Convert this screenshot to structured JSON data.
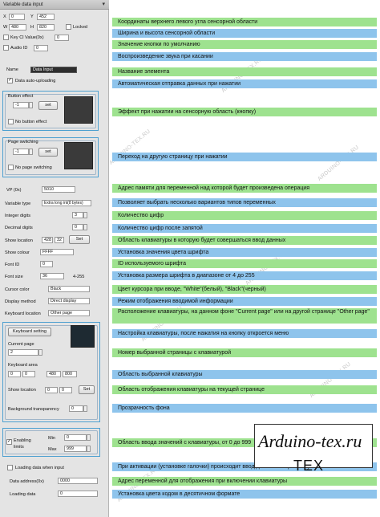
{
  "panel": {
    "title": "Variable data input",
    "close_glyph": "▾",
    "x_label": "X",
    "x_value": "0",
    "y_label": "Y",
    "y_value": "452",
    "w_label": "W",
    "w_value": "480",
    "h_label": "H",
    "h_value": "820",
    "locked_label": "Locked",
    "key_cl_label": "Key Cl Value(0x)",
    "key_cl_value": "0",
    "audio_id_label": "Audio ID",
    "audio_id_value": "0",
    "name_label": "Name",
    "name_value": "Data Input",
    "data_auto_uploading_label": "Data auto-uploading",
    "button_effect_label": "Button effect",
    "button_effect_value": "-1",
    "set_label": "set",
    "no_button_effect_label": "No button effect",
    "page_switching_label": "Page switching",
    "page_switching_value": "-1",
    "no_page_switching_label": "No page switching",
    "vp_label": "VP (0x)",
    "vp_value": "5010",
    "variable_type_label": "Variable type",
    "variable_type_value": "Extra long int(8 bytes)",
    "integer_digits_label": "Integer digits",
    "integer_digits_value": "3",
    "decimal_digits_label": "Decimal digits",
    "decimal_digits_value": "0",
    "show_location_label": "Show location",
    "show_location_x": "428",
    "show_location_y": "32",
    "set_button_label": "Set",
    "show_colour_label": "Show colour",
    "show_colour_value": "FFFF",
    "font_id_label": "Font ID",
    "font_id_value": "0",
    "font_size_label": "Font size",
    "font_size_value": "36",
    "font_size_range": "4-255",
    "cursor_color_label": "Cursor color",
    "cursor_color_value": "Black",
    "display_method_label": "Display method",
    "display_method_value": "Direct display",
    "keyboard_location_label": "Keyboard location",
    "keyboard_location_value": "Other page",
    "keyboard_setting_label": "Keyboard setting",
    "current_page_label": "Current page",
    "current_page_value": "2",
    "keyboard_area_label": "Keyboard area",
    "ka_x1": "0",
    "ka_y1": "0",
    "ka_x2": "480",
    "ka_y2": "800",
    "kb_show_location_label": "Show location",
    "kb_show_x": "0",
    "kb_show_y": "0",
    "kb_set_label": "Set",
    "background_transparency_label": "Background transparency",
    "background_transparency_value": "0",
    "enabling_limits_label": "Enabling limits",
    "min_label": "Min",
    "min_value": "0",
    "max_label": "Max",
    "max_value": "999",
    "loading_data_when_input_label": "Loading data when input",
    "data_address_label": "Data address(0x)",
    "data_address_value": "0000",
    "loading_data_label": "Loading data",
    "loading_data_value": "0"
  },
  "annotations": [
    {
      "text": "Координаты верхнего левого угла сенсорной области",
      "color": "green"
    },
    {
      "text": "Ширина и высота сенсорной области",
      "color": "blue"
    },
    {
      "text": "Значение кнопки по умолчанию",
      "color": "green"
    },
    {
      "text": "Воспроизведение звука при касании",
      "color": "blue"
    },
    {
      "text": "Название элемента",
      "color": "green"
    },
    {
      "text": "Автоматическая отправка данных при нажатии",
      "color": "blue"
    },
    {
      "text": "Эффект при нажатии на сенсорную область (кнопку)",
      "color": "green"
    },
    {
      "text": "Переход на другую страницу при нажатии",
      "color": "blue"
    },
    {
      "text": "Адрес памяти для переменной над которой будет произведена операция",
      "color": "green"
    },
    {
      "text": "Позволяет выбрать несколько вариантов типов переменных",
      "color": "blue"
    },
    {
      "text": "Количество цифр",
      "color": "green"
    },
    {
      "text": "Количество цифр после запятой",
      "color": "blue"
    },
    {
      "text": "Область клавиатуры в которую будет совершаться ввод данных",
      "color": "green"
    },
    {
      "text": "Установка значения цвета шрифта",
      "color": "blue"
    },
    {
      "text": "ID используемого шрифта",
      "color": "green"
    },
    {
      "text": "Установка размера шрифта в диапазоне от 4 до 255",
      "color": "blue"
    },
    {
      "text": "Цвет курсора при вводе, \"White\"(белый), \"Black\"(черный)",
      "color": "green"
    },
    {
      "text": "Режим отображения вводимой информации",
      "color": "blue"
    },
    {
      "text": "Расположение клавиатуры, на данном фоне \"Current page\" или на другой странице \"Other page\"",
      "color": "green"
    },
    {
      "text": "Настройка клавиатуры, после нажатия на кнопку откроется меню",
      "color": "blue"
    },
    {
      "text": "Номер выбранной страницы с клавиатурой",
      "color": "green"
    },
    {
      "text": "Область выбранной клавиатуры",
      "color": "blue"
    },
    {
      "text": "Область отображения клавиатуры на текущей странице",
      "color": "green"
    },
    {
      "text": "Прозрачность фона",
      "color": "blue"
    },
    {
      "text": "Область ввода значений с клавиатуры, от 0 до 999",
      "color": "green"
    },
    {
      "text": "При активации (установке галочки) происходит ввод данных в переменную",
      "color": "blue"
    },
    {
      "text": "Адрес переменной для отображения при включении клавиатуры",
      "color": "green"
    },
    {
      "text": "Установка цвета кодом в десятичном формате",
      "color": "blue"
    }
  ],
  "watermark": "ARDUINO-TEX.RU",
  "logo": {
    "line1": "Arduino-tex.ru",
    "line2": "TEX"
  }
}
